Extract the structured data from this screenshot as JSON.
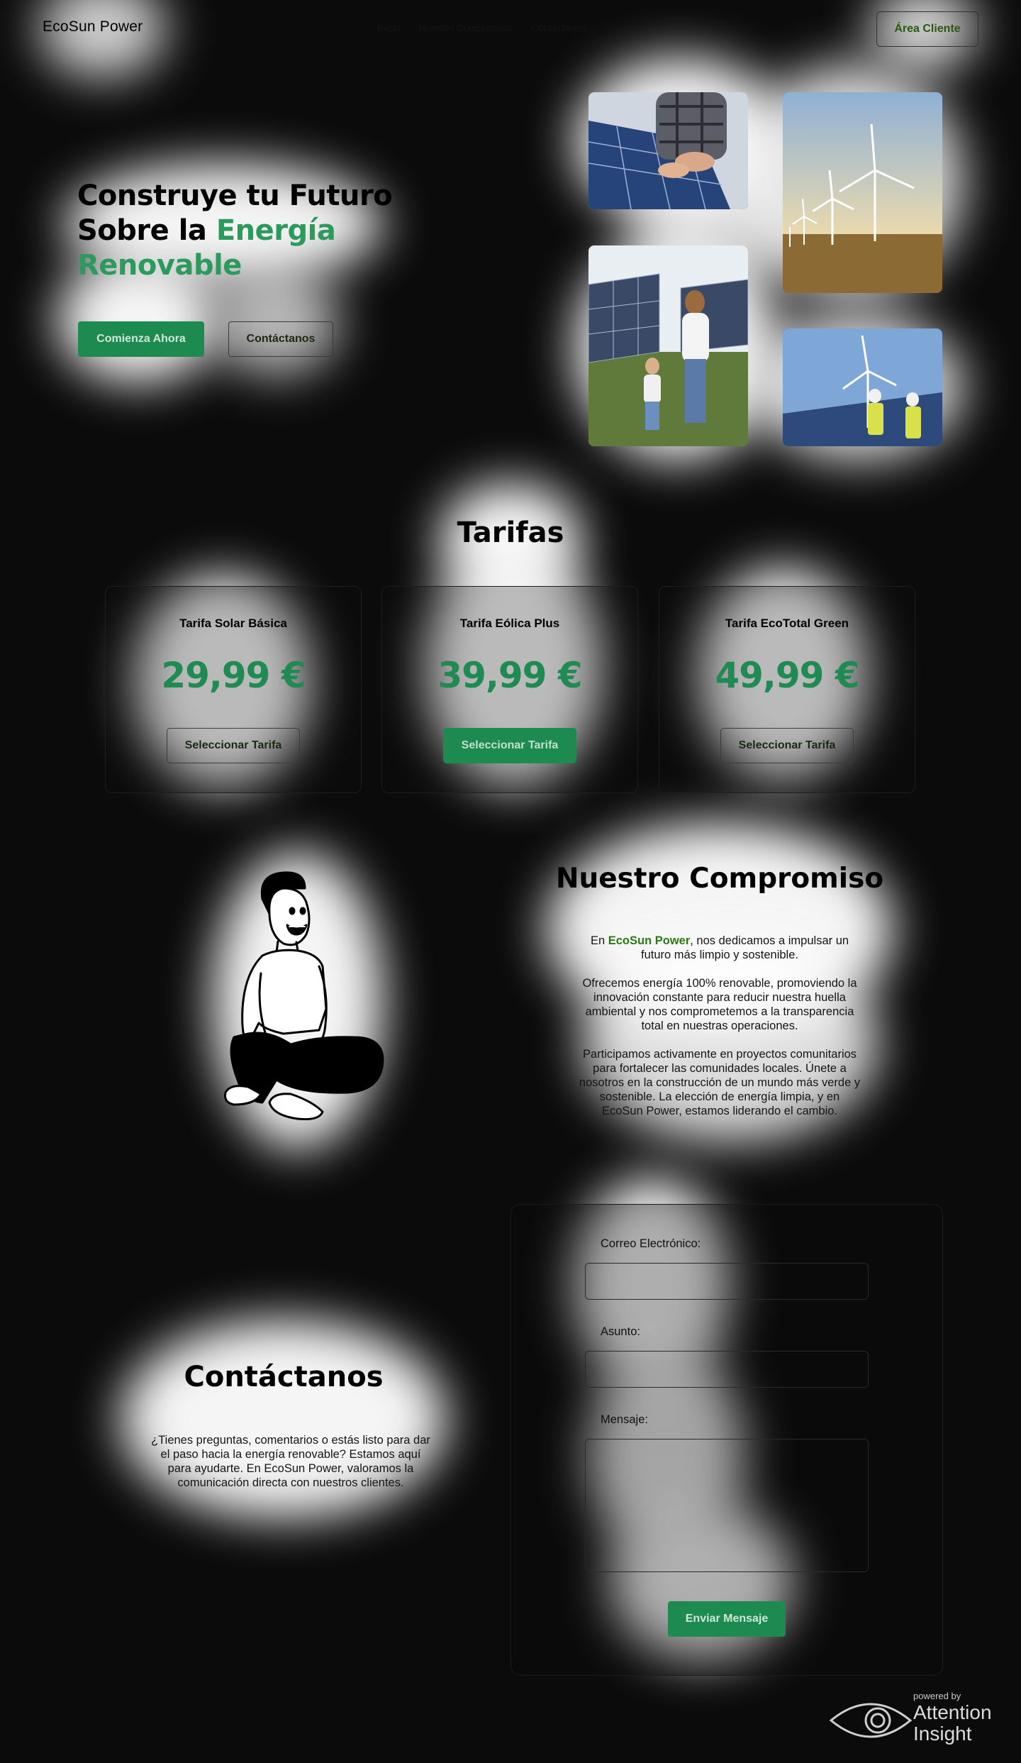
{
  "header": {
    "brand": "EcoSun Power",
    "nav": [
      "Inicio",
      "Nuestro Compromiso",
      "Contáctanos"
    ],
    "client_button": "Área Cliente"
  },
  "hero": {
    "title_line1": "Construye tu Futuro",
    "title_line2_prefix": "Sobre la ",
    "title_line2_accent": "Energía",
    "title_line3_accent": "Renovable",
    "primary_button": "Comienza Ahora",
    "secondary_button": "Contáctanos",
    "photos": [
      "solar-panel-hands-photo",
      "wind-turbines-photo",
      "family-solar-field-photo",
      "engineers-wind-turbine-photo"
    ]
  },
  "tarifas": {
    "title": "Tarifas",
    "cards": [
      {
        "name": "Tarifa Solar Básica",
        "price": "29,99 €",
        "button": "Seleccionar Tarifa",
        "style": "outline"
      },
      {
        "name": "Tarifa Eólica Plus",
        "price": "39,99 €",
        "button": "Seleccionar Tarifa",
        "style": "filled"
      },
      {
        "name": "Tarifa EcoTotal Green",
        "price": "49,99 €",
        "button": "Seleccionar Tarifa",
        "style": "outline"
      }
    ]
  },
  "compromiso": {
    "title": "Nuestro Compromiso",
    "p1_prefix": "En ",
    "p1_brand": "EcoSun Power",
    "p1_rest": ", nos dedicamos a impulsar un futuro más limpio y sostenible.",
    "p2": "Ofrecemos energía 100% renovable, promoviendo la innovación constante para reducir nuestra huella ambiental y nos comprometemos a la transparencia total en nuestras operaciones.",
    "p3": "Participamos activamente en proyectos comunitarios para fortalecer las comunidades locales. Únete a nosotros en la construcción de un mundo más verde y sostenible. La elección de energía limpia, y en EcoSun Power, estamos liderando el cambio."
  },
  "contacto": {
    "title": "Contáctanos",
    "text": "¿Tienes preguntas, comentarios o estás listo para dar el paso hacia la energía renovable? Estamos aquí para ayudarte. En EcoSun Power, valoramos la comunicación directa con nuestros clientes.",
    "email_label": "Correo Electrónico:",
    "subject_label": "Asunto:",
    "message_label": "Mensaje:",
    "submit": "Enviar Mensaje"
  },
  "watermark": {
    "powered_by": "powered by",
    "word1": "Attention",
    "word2": "Insight"
  },
  "colors": {
    "background": "#0b0b0b",
    "accent_green": "#1f8a52",
    "heat": "#ffffff"
  }
}
